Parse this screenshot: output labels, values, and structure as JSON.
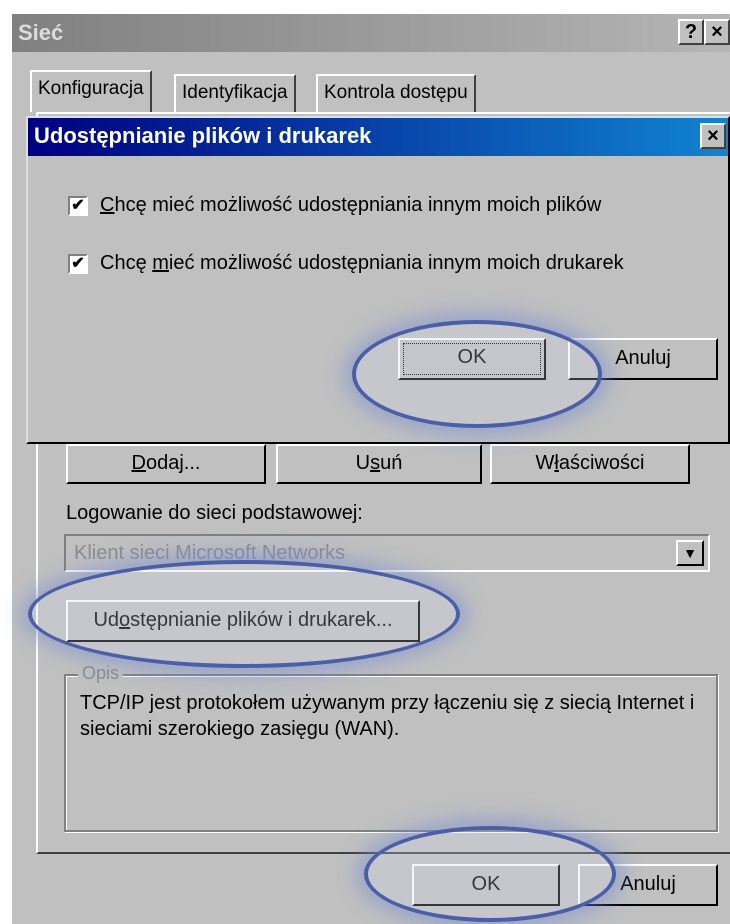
{
  "window": {
    "title": "Sieć",
    "help_button": "?",
    "close_button": "×"
  },
  "tabs": [
    {
      "label": "Konfiguracja"
    },
    {
      "label": "Identyfikacja"
    },
    {
      "label": "Kontrola dostępu"
    }
  ],
  "dialog": {
    "title": "Udostępnianie plików i drukarek",
    "close_button": "×",
    "checkboxes": [
      {
        "label_prefix": "",
        "label_underlined": "C",
        "label_rest": "hcę mieć możliwość udostępniania innym moich plików",
        "checked": true,
        "mark": "✔"
      },
      {
        "label_prefix": "Chcę ",
        "label_underlined": "m",
        "label_rest": "ieć możliwość udostępniania innym moich drukarek",
        "checked": true,
        "mark": "✔"
      }
    ],
    "ok_label": "OK",
    "cancel_label": "Anuluj"
  },
  "buttons": {
    "add_prefix": "",
    "add_underlined": "D",
    "add_rest": "odaj...",
    "remove_prefix": "U",
    "remove_underlined": "s",
    "remove_rest": "uń",
    "props_prefix": "W",
    "props_underlined": "ł",
    "props_rest": "aściwości"
  },
  "logon": {
    "label": "Logowanie do sieci podstawowej:",
    "value": "Klient sieci Microsoft Networks",
    "arrow": "▼"
  },
  "share_button": {
    "prefix": "Ud",
    "underlined": "o",
    "rest": "stępnianie plików i drukarek..."
  },
  "description": {
    "title": "Opis",
    "text": "TCP/IP jest protokołem używanym przy łączeniu się z siecią Internet i sieciami szerokiego zasięgu (WAN)."
  },
  "footer": {
    "ok_label": "OK",
    "cancel_label": "Anuluj"
  }
}
